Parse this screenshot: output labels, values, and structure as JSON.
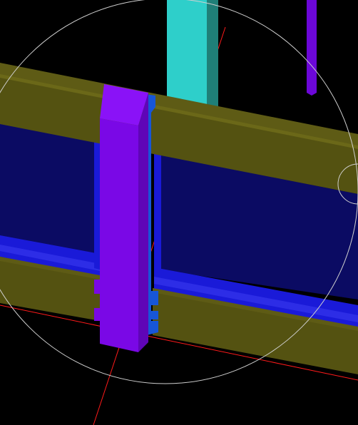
{
  "viewport": {
    "background": "#000000",
    "colors": {
      "beam_top": "#5e5b15",
      "beam_face": "#545211",
      "beam_edge": "#6b6818",
      "panel_fill": "#0b0b63",
      "panel_frame": "#1a1ad8",
      "panel_frame_light": "#2d2de6",
      "column_cyan": "#2ecfca",
      "column_cyan_side": "#1f7f78",
      "post_violet": "#7a08e6",
      "post_violet_top": "#8a12f7",
      "post_violet_side": "#5f05b7",
      "post_blue": "#1756d8",
      "grid_line_red": "#ff1a1a",
      "pivot_circle": "#cfcfcf",
      "thin_post": "#6c07d8"
    },
    "icons": [
      "orbit-pivot-circle",
      "axis-line"
    ]
  }
}
